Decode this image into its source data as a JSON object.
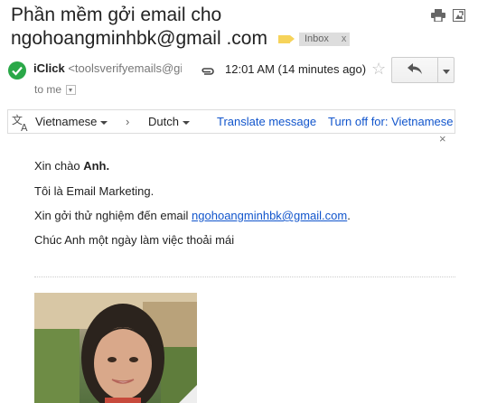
{
  "email": {
    "subject": "Phần mềm gởi email cho ngohoangminhbk@gmail .com",
    "label_chip": "Inbox",
    "label_chip_close": "x",
    "sender_name": "iClick",
    "sender_email": "<toolsverifyemails@gi",
    "time": "12:01 AM (14 minutes ago)",
    "to_me": "to me"
  },
  "translate_bar": {
    "source_lang": "Vietnamese",
    "arrow": "›",
    "target_lang": "Dutch",
    "translate_link": "Translate message",
    "turn_off_link": "Turn off for: Vietnamese",
    "close": "×"
  },
  "body": {
    "line1_prefix": "Xin chào ",
    "line1_name": "Anh.",
    "line2": "Tôi là Email Marketing.",
    "line3_prefix": "Xin gởi thử nghiệm đến email ",
    "line3_link": "ngohoangminhbk@gmail.com",
    "line3_suffix": ".",
    "line4": "Chúc Anh một ngày làm việc thoải mái"
  },
  "icons": {
    "print": "print-icon",
    "new_window": "new-window-icon",
    "avatar": "verified-check-icon",
    "attachment": "paperclip-icon",
    "star": "star-icon",
    "reply": "reply-icon",
    "more": "chevron-down-icon",
    "translate": "translate-icon"
  },
  "colors": {
    "avatar": "#2aa848",
    "link": "#1155cc",
    "label_tag": "#f6d35a",
    "chip_bg": "#dddddd"
  }
}
